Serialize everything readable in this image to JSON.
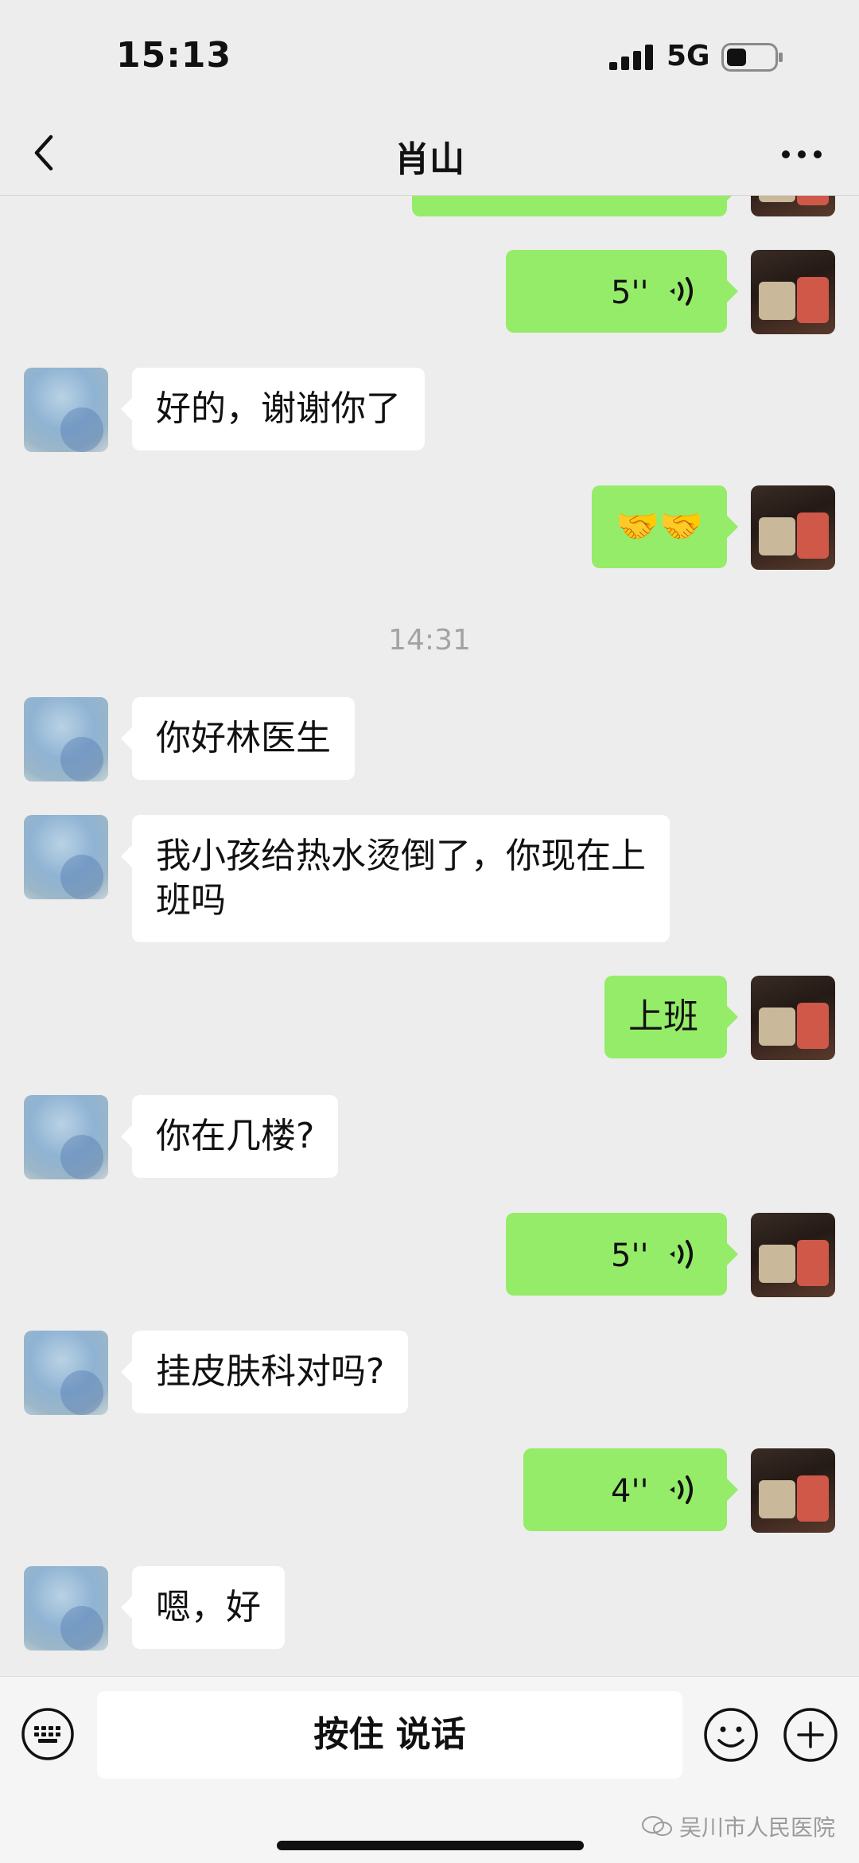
{
  "status_bar": {
    "time": "15:13",
    "network": "5G"
  },
  "nav": {
    "title": "肖山"
  },
  "messages": {
    "m1": {
      "duration": "5''"
    },
    "m2": {
      "text": "好的，谢谢你了"
    },
    "m3": {
      "text": "🤝🤝"
    },
    "time_divider": "14:31",
    "m4": {
      "text": "你好林医生"
    },
    "m5": {
      "line1": "我小孩给热水烫倒了，你现在上",
      "line2": "班吗"
    },
    "m6": {
      "text": "上班"
    },
    "m7": {
      "text": "你在几楼?"
    },
    "m8": {
      "duration": "5''"
    },
    "m9": {
      "text": "挂皮肤科对吗?"
    },
    "m10": {
      "duration": "4''"
    },
    "m11": {
      "text": "嗯，好"
    }
  },
  "input_bar": {
    "hold_to_talk": "按住 说话"
  },
  "watermark": "吴川市人民医院",
  "colors": {
    "background": "#ededed",
    "sent_bubble": "#95ec69",
    "received_bubble": "#ffffff",
    "timestamp": "#a3a3a3"
  }
}
